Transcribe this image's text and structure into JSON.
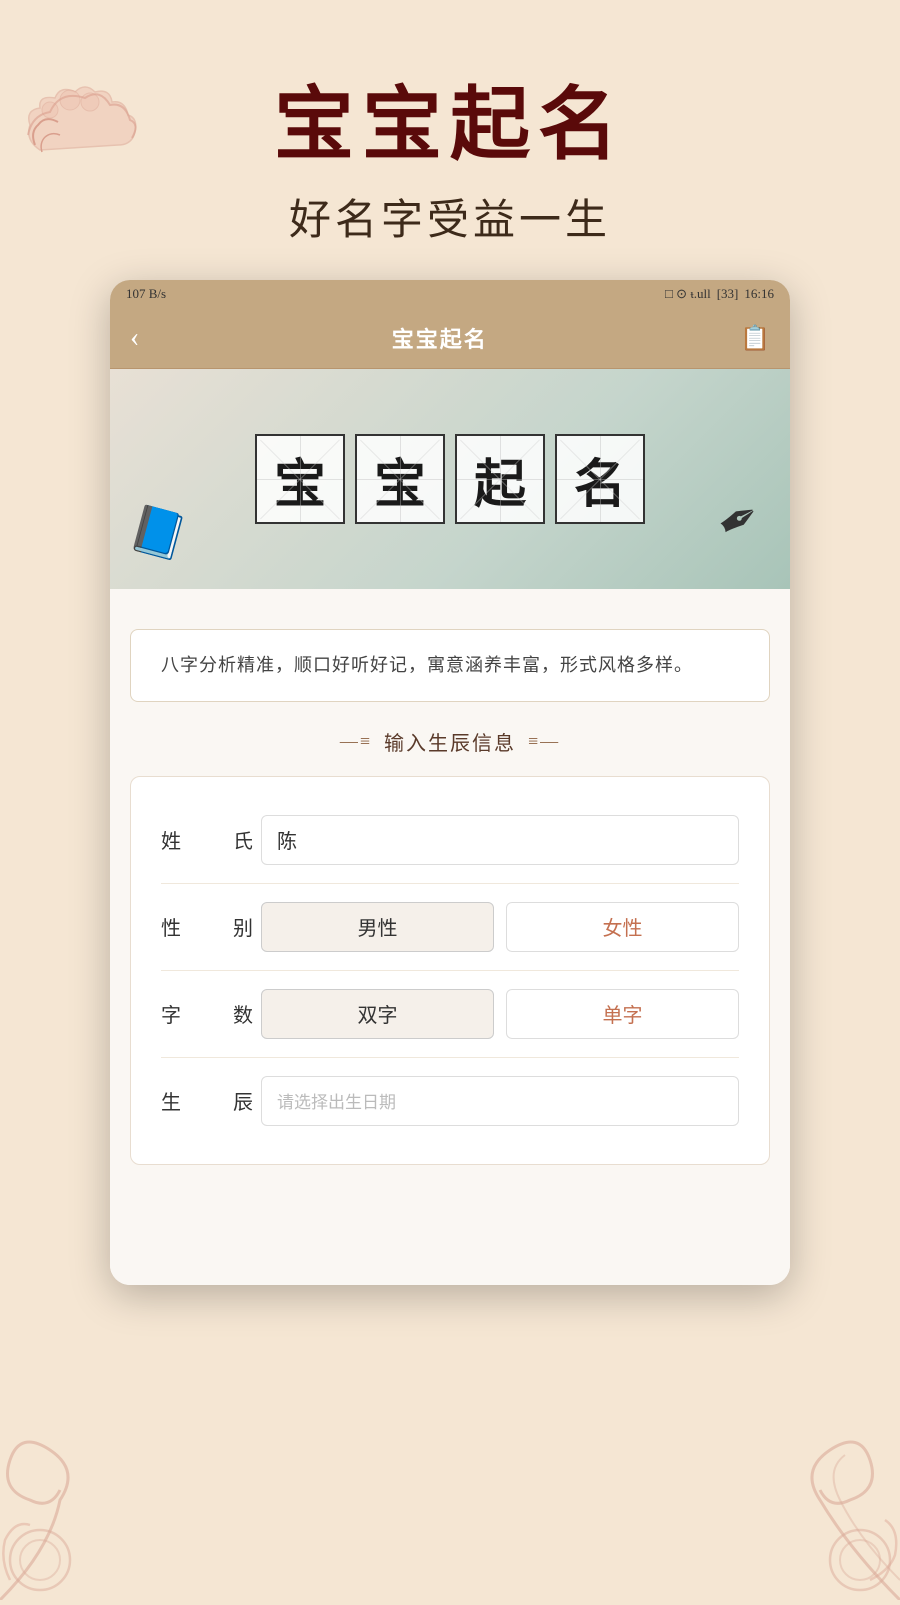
{
  "page": {
    "background_color": "#f5e6d3"
  },
  "header": {
    "main_title": "宝宝起名",
    "sub_title": "好名字受益一生"
  },
  "status_bar": {
    "network_speed": "107 B/s",
    "time": "16:16",
    "battery": "33"
  },
  "nav": {
    "back_icon": "‹",
    "title": "宝宝起名",
    "menu_icon": "📋"
  },
  "banner": {
    "chars": [
      "宝",
      "宝",
      "起",
      "名"
    ]
  },
  "description": {
    "text": "八字分析精准，顺口好听好记，寓意涵养丰富，形式风格多样。"
  },
  "section": {
    "title": "输入生辰信息"
  },
  "form": {
    "surname_label": "姓  氏",
    "surname_value": "陈",
    "gender_label": "性  别",
    "gender_male": "男性",
    "gender_female": "女性",
    "chars_label": "字  数",
    "chars_double": "双字",
    "chars_single": "单字",
    "birth_label": "生  辰",
    "birth_placeholder": "请选择出生日期"
  }
}
